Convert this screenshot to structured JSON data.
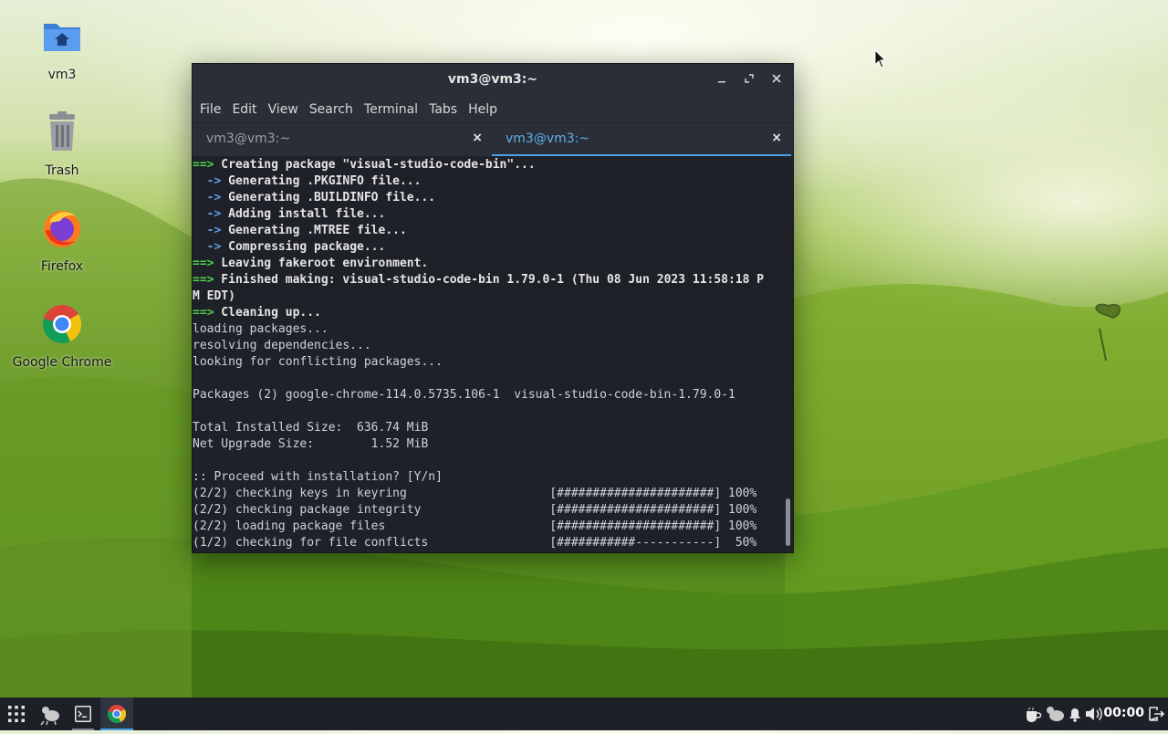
{
  "desktop": {
    "icons": [
      {
        "label": "vm3",
        "icon": "home-folder-icon"
      },
      {
        "label": "Trash",
        "icon": "trash-icon"
      },
      {
        "label": "Firefox",
        "icon": "firefox-icon"
      },
      {
        "label": "Google Chrome",
        "icon": "chrome-icon"
      }
    ]
  },
  "window": {
    "title": "vm3@vm3:~",
    "menu": [
      "File",
      "Edit",
      "View",
      "Search",
      "Terminal",
      "Tabs",
      "Help"
    ],
    "tabs": [
      {
        "label": "vm3@vm3:~",
        "active": false
      },
      {
        "label": "vm3@vm3:~",
        "active": true
      }
    ],
    "close_glyph": "×"
  },
  "terminal": {
    "lines": [
      {
        "prefix": "==>",
        "kind": "main",
        "text": " Creating package \"visual-studio-code-bin\"..."
      },
      {
        "prefix": "  ->",
        "kind": "sub",
        "text": " Generating .PKGINFO file..."
      },
      {
        "prefix": "  ->",
        "kind": "sub",
        "text": " Generating .BUILDINFO file..."
      },
      {
        "prefix": "  ->",
        "kind": "sub",
        "text": " Adding install file..."
      },
      {
        "prefix": "  ->",
        "kind": "sub",
        "text": " Generating .MTREE file..."
      },
      {
        "prefix": "  ->",
        "kind": "sub",
        "text": " Compressing package..."
      },
      {
        "prefix": "==>",
        "kind": "main",
        "text": " Leaving fakeroot environment."
      },
      {
        "prefix": "==>",
        "kind": "main",
        "text": " Finished making: visual-studio-code-bin 1.79.0-1 (Thu 08 Jun 2023 11:58:18 P"
      },
      {
        "prefix": "",
        "kind": "boldplain",
        "text": "M EDT)"
      },
      {
        "prefix": "==>",
        "kind": "main",
        "text": " Cleaning up..."
      },
      {
        "prefix": "",
        "kind": "plain",
        "text": "loading packages..."
      },
      {
        "prefix": "",
        "kind": "plain",
        "text": "resolving dependencies..."
      },
      {
        "prefix": "",
        "kind": "plain",
        "text": "looking for conflicting packages..."
      },
      {
        "prefix": "",
        "kind": "plain",
        "text": ""
      },
      {
        "prefix": "",
        "kind": "plain",
        "text": "Packages (2) google-chrome-114.0.5735.106-1  visual-studio-code-bin-1.79.0-1"
      },
      {
        "prefix": "",
        "kind": "plain",
        "text": ""
      },
      {
        "prefix": "",
        "kind": "plain",
        "text": "Total Installed Size:  636.74 MiB"
      },
      {
        "prefix": "",
        "kind": "plain",
        "text": "Net Upgrade Size:        1.52 MiB"
      },
      {
        "prefix": "",
        "kind": "plain",
        "text": ""
      },
      {
        "prefix": "",
        "kind": "plain",
        "text": ":: Proceed with installation? [Y/n]"
      },
      {
        "prefix": "",
        "kind": "plain",
        "text": "(2/2) checking keys in keyring                    [######################] 100%"
      },
      {
        "prefix": "",
        "kind": "plain",
        "text": "(2/2) checking package integrity                  [######################] 100%"
      },
      {
        "prefix": "",
        "kind": "plain",
        "text": "(2/2) loading package files                       [######################] 100%"
      },
      {
        "prefix": "",
        "kind": "plain",
        "text": "(1/2) checking for file conflicts                 [###########-----------]  50%"
      }
    ]
  },
  "taskbar": {
    "apps": [
      "app-grid-icon",
      "xfce-mouse-icon",
      "terminal-icon",
      "chrome-icon"
    ],
    "tray": [
      "coffee-icon",
      "xfce-mouse-icon",
      "bell-icon",
      "volume-icon"
    ],
    "clock": "00:00",
    "logout": "logout-icon"
  },
  "colors": {
    "terminal_bg": "#1f2128",
    "titlebar_bg": "#2b2e37",
    "accent": "#4a9fe8",
    "green_prompt": "#4fd14f",
    "blue_prompt": "#5d9ce8"
  }
}
